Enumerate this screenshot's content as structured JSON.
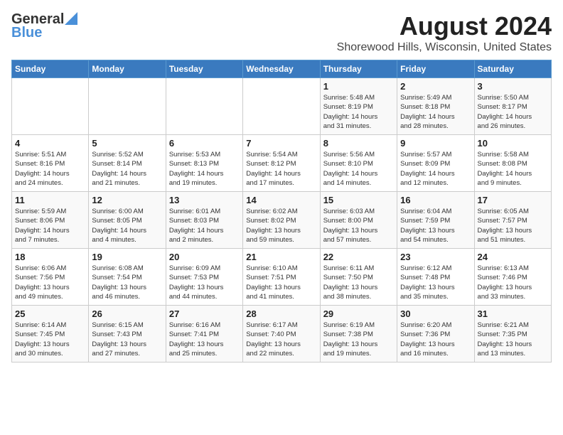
{
  "header": {
    "logo_general": "General",
    "logo_blue": "Blue",
    "month_year": "August 2024",
    "location": "Shorewood Hills, Wisconsin, United States"
  },
  "days_of_week": [
    "Sunday",
    "Monday",
    "Tuesday",
    "Wednesday",
    "Thursday",
    "Friday",
    "Saturday"
  ],
  "weeks": [
    [
      {
        "day": "",
        "info": ""
      },
      {
        "day": "",
        "info": ""
      },
      {
        "day": "",
        "info": ""
      },
      {
        "day": "",
        "info": ""
      },
      {
        "day": "1",
        "info": "Sunrise: 5:48 AM\nSunset: 8:19 PM\nDaylight: 14 hours\nand 31 minutes."
      },
      {
        "day": "2",
        "info": "Sunrise: 5:49 AM\nSunset: 8:18 PM\nDaylight: 14 hours\nand 28 minutes."
      },
      {
        "day": "3",
        "info": "Sunrise: 5:50 AM\nSunset: 8:17 PM\nDaylight: 14 hours\nand 26 minutes."
      }
    ],
    [
      {
        "day": "4",
        "info": "Sunrise: 5:51 AM\nSunset: 8:16 PM\nDaylight: 14 hours\nand 24 minutes."
      },
      {
        "day": "5",
        "info": "Sunrise: 5:52 AM\nSunset: 8:14 PM\nDaylight: 14 hours\nand 21 minutes."
      },
      {
        "day": "6",
        "info": "Sunrise: 5:53 AM\nSunset: 8:13 PM\nDaylight: 14 hours\nand 19 minutes."
      },
      {
        "day": "7",
        "info": "Sunrise: 5:54 AM\nSunset: 8:12 PM\nDaylight: 14 hours\nand 17 minutes."
      },
      {
        "day": "8",
        "info": "Sunrise: 5:56 AM\nSunset: 8:10 PM\nDaylight: 14 hours\nand 14 minutes."
      },
      {
        "day": "9",
        "info": "Sunrise: 5:57 AM\nSunset: 8:09 PM\nDaylight: 14 hours\nand 12 minutes."
      },
      {
        "day": "10",
        "info": "Sunrise: 5:58 AM\nSunset: 8:08 PM\nDaylight: 14 hours\nand 9 minutes."
      }
    ],
    [
      {
        "day": "11",
        "info": "Sunrise: 5:59 AM\nSunset: 8:06 PM\nDaylight: 14 hours\nand 7 minutes."
      },
      {
        "day": "12",
        "info": "Sunrise: 6:00 AM\nSunset: 8:05 PM\nDaylight: 14 hours\nand 4 minutes."
      },
      {
        "day": "13",
        "info": "Sunrise: 6:01 AM\nSunset: 8:03 PM\nDaylight: 14 hours\nand 2 minutes."
      },
      {
        "day": "14",
        "info": "Sunrise: 6:02 AM\nSunset: 8:02 PM\nDaylight: 13 hours\nand 59 minutes."
      },
      {
        "day": "15",
        "info": "Sunrise: 6:03 AM\nSunset: 8:00 PM\nDaylight: 13 hours\nand 57 minutes."
      },
      {
        "day": "16",
        "info": "Sunrise: 6:04 AM\nSunset: 7:59 PM\nDaylight: 13 hours\nand 54 minutes."
      },
      {
        "day": "17",
        "info": "Sunrise: 6:05 AM\nSunset: 7:57 PM\nDaylight: 13 hours\nand 51 minutes."
      }
    ],
    [
      {
        "day": "18",
        "info": "Sunrise: 6:06 AM\nSunset: 7:56 PM\nDaylight: 13 hours\nand 49 minutes."
      },
      {
        "day": "19",
        "info": "Sunrise: 6:08 AM\nSunset: 7:54 PM\nDaylight: 13 hours\nand 46 minutes."
      },
      {
        "day": "20",
        "info": "Sunrise: 6:09 AM\nSunset: 7:53 PM\nDaylight: 13 hours\nand 44 minutes."
      },
      {
        "day": "21",
        "info": "Sunrise: 6:10 AM\nSunset: 7:51 PM\nDaylight: 13 hours\nand 41 minutes."
      },
      {
        "day": "22",
        "info": "Sunrise: 6:11 AM\nSunset: 7:50 PM\nDaylight: 13 hours\nand 38 minutes."
      },
      {
        "day": "23",
        "info": "Sunrise: 6:12 AM\nSunset: 7:48 PM\nDaylight: 13 hours\nand 35 minutes."
      },
      {
        "day": "24",
        "info": "Sunrise: 6:13 AM\nSunset: 7:46 PM\nDaylight: 13 hours\nand 33 minutes."
      }
    ],
    [
      {
        "day": "25",
        "info": "Sunrise: 6:14 AM\nSunset: 7:45 PM\nDaylight: 13 hours\nand 30 minutes."
      },
      {
        "day": "26",
        "info": "Sunrise: 6:15 AM\nSunset: 7:43 PM\nDaylight: 13 hours\nand 27 minutes."
      },
      {
        "day": "27",
        "info": "Sunrise: 6:16 AM\nSunset: 7:41 PM\nDaylight: 13 hours\nand 25 minutes."
      },
      {
        "day": "28",
        "info": "Sunrise: 6:17 AM\nSunset: 7:40 PM\nDaylight: 13 hours\nand 22 minutes."
      },
      {
        "day": "29",
        "info": "Sunrise: 6:19 AM\nSunset: 7:38 PM\nDaylight: 13 hours\nand 19 minutes."
      },
      {
        "day": "30",
        "info": "Sunrise: 6:20 AM\nSunset: 7:36 PM\nDaylight: 13 hours\nand 16 minutes."
      },
      {
        "day": "31",
        "info": "Sunrise: 6:21 AM\nSunset: 7:35 PM\nDaylight: 13 hours\nand 13 minutes."
      }
    ]
  ]
}
